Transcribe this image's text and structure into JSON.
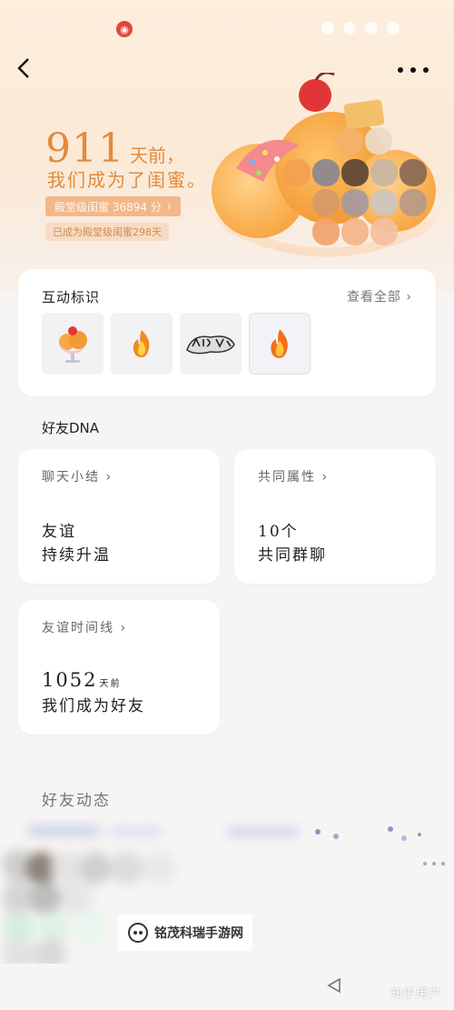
{
  "header": {
    "days": "911",
    "days_unit": "天前，",
    "subtitle": "我们成为了闺蜜。",
    "level_label": "殿堂级闺蜜 36894 分",
    "level_arrow": "›",
    "level_sub": "已成为殿堂级闺蜜298天"
  },
  "badges": {
    "title": "互动标识",
    "see_all": "查看全部",
    "see_all_arrow": "›",
    "items": [
      {
        "icon": "ice-cream-sundae-icon"
      },
      {
        "icon": "flame-icon"
      },
      {
        "icon": "text-art-badge-icon"
      },
      {
        "icon": "flame-icon"
      }
    ]
  },
  "dna": {
    "title": "好友DNA",
    "chat": {
      "head": "聊天小结",
      "arrow": "›",
      "line1": "友谊",
      "line2": "持续升温"
    },
    "attrs": {
      "head": "共同属性",
      "arrow": "›",
      "line1": "10个",
      "line2": "共同群聊"
    },
    "timeline": {
      "head": "友谊时间线",
      "arrow": "›",
      "num": "1052",
      "unit": "天前",
      "line2": "我们成为好友"
    }
  },
  "feed": {
    "title": "好友动态"
  },
  "watermark": {
    "text": "铭茂科瑞手游网"
  },
  "footer": {
    "credit": "知乎用户"
  },
  "colors": {
    "accent": "#e18b3c",
    "tag_bg": "#f3b88a",
    "page_bg": "#f7f5f3"
  }
}
